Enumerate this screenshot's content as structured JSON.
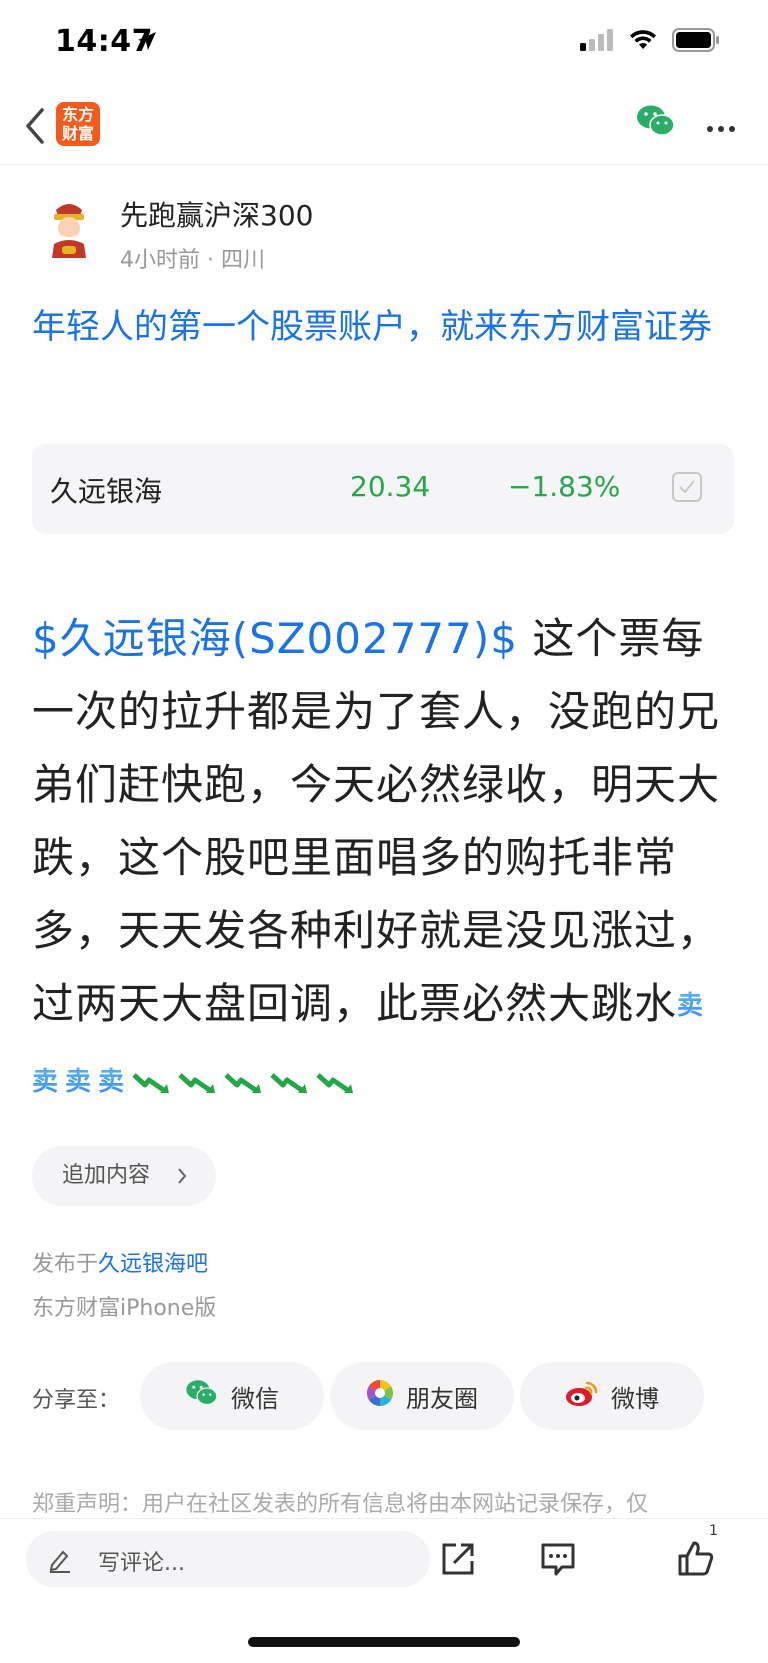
{
  "status_bar": {
    "time": "14:47"
  },
  "nav": {
    "logo_line1": "东方",
    "logo_line2": "财富"
  },
  "author": {
    "name": "先跑赢沪深300",
    "meta": "4小时前 · 四川"
  },
  "headline": "年轻人的第一个股票账户，就来东方财富证券",
  "stock": {
    "name": "久远银海",
    "price": "20.34",
    "change": "−1.83%"
  },
  "post": {
    "tag": "$久远银海(SZ002777)$",
    "text": "  这个票每一次的拉升都是为了套人，没跑的兄弟们赶快跑，今天必然绿收，明天大跌，这个股吧里面唱多的购托非常多，天天发各种利好就是没见涨过，过两天大盘回调，此票必然大跳水",
    "emoji_sell": "卖"
  },
  "append_label": "追加内容",
  "source": {
    "prefix": "发布于",
    "forum": "久远银海吧",
    "device": "东方财富iPhone版"
  },
  "share": {
    "label": "分享至：",
    "wechat": "微信",
    "moments": "朋友圈",
    "weibo": "微博"
  },
  "disclaimer": "郑重声明：用户在社区发表的所有信息将由本网站记录保存，仅",
  "bottom": {
    "comment_placeholder": "写评论...",
    "like_count": "1"
  },
  "colors": {
    "brand_orange": "#f55a1a",
    "link_blue": "#1a73e8",
    "stock_green": "#22a846",
    "wechat_green": "#2aae67"
  }
}
